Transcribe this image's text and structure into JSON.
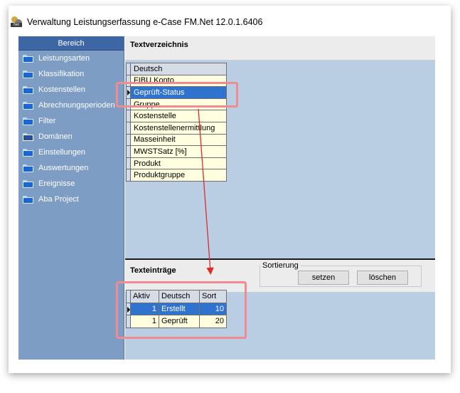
{
  "window": {
    "title": "Verwaltung Leistungserfassung e-Case FM.Net 12.0.1.6406"
  },
  "colors": {
    "sidebar_bg": "#7e9dc4",
    "header_bg": "#3d67a4",
    "selection": "#2f73cf",
    "cell_bg": "#ffffe0",
    "highlight": "#f08c91",
    "arrow": "#e02a2a"
  },
  "sidebar": {
    "header": "Bereich",
    "items": [
      {
        "label": "Leistungsarten",
        "icon": "folder-icon"
      },
      {
        "label": "Klassifikation",
        "icon": "folder-icon"
      },
      {
        "label": "Kostenstellen",
        "icon": "folder-icon"
      },
      {
        "label": "Abrechnungsperioden",
        "icon": "folder-icon"
      },
      {
        "label": "Filter",
        "icon": "folder-icon"
      },
      {
        "label": "Domänen",
        "icon": "folder-open-icon",
        "active": true
      },
      {
        "label": "Einstellungen",
        "icon": "folder-icon"
      },
      {
        "label": "Auswertungen",
        "icon": "folder-icon"
      },
      {
        "label": "Ereignisse",
        "icon": "folder-icon"
      },
      {
        "label": "Aba Project",
        "icon": "folder-icon"
      }
    ]
  },
  "textverzeichnis": {
    "title": "Textverzeichnis",
    "column": "Deutsch",
    "rows": [
      "FIBU Konto",
      "Geprüft-Status",
      "Gruppe",
      "Kostenstelle",
      "Kostenstellenermittlung",
      "Masseinheit",
      "MWSTSatz [%]",
      "Produkt",
      "Produktgruppe"
    ],
    "selected_row": "Geprüft-Status"
  },
  "texteintraege": {
    "title": "Texteinträge",
    "columns": {
      "aktiv": "Aktiv",
      "deutsch": "Deutsch",
      "sort": "Sort"
    },
    "rows": [
      {
        "aktiv": "1",
        "deutsch": "Erstellt",
        "sort": "10",
        "selected": true
      },
      {
        "aktiv": "1",
        "deutsch": "Geprüft",
        "sort": "20"
      }
    ]
  },
  "sortierung": {
    "label": "Sortierung",
    "setzen": "setzen",
    "loeschen": "löschen"
  }
}
